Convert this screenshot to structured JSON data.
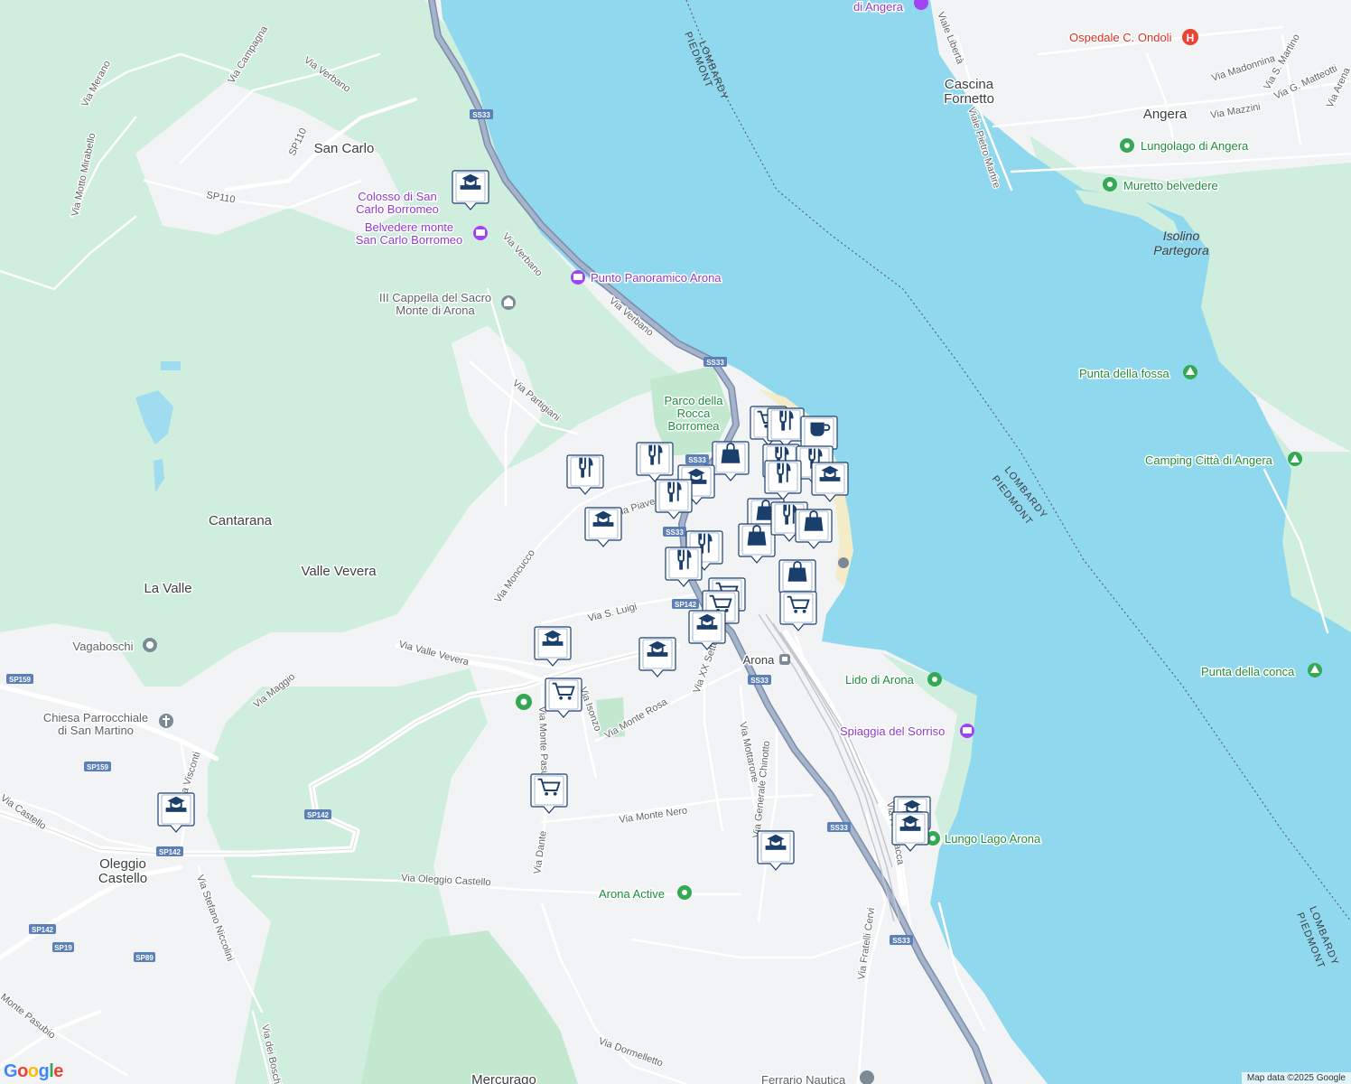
{
  "map": {
    "towns": [
      {
        "name": "San Carlo"
      },
      {
        "name": "Cantarana"
      },
      {
        "name": "Valle Vevera"
      },
      {
        "name": "La Valle"
      },
      {
        "name": "Oleggio"
      },
      {
        "name": "Castello"
      },
      {
        "name": "Angera"
      },
      {
        "name": "Cascina"
      },
      {
        "name": "Fornetto"
      },
      {
        "name": "Arona"
      },
      {
        "name": "Mercurago"
      }
    ],
    "water_labels": [
      {
        "name": "Isolino"
      },
      {
        "name": "Partegora"
      }
    ],
    "borders": [
      {
        "a": "LOMBARDY",
        "b": "PIEDMONT"
      }
    ],
    "roads": [
      "Via Merano",
      "Via Campagna",
      "Via Verbano",
      "Via Motto Mirabello",
      "SP110",
      "SP110",
      "Via Verbano",
      "Via Verbano",
      "Via Partigiani",
      "Via Piave",
      "Via Moncucco",
      "Via S. Luigi",
      "Via Valle Vevera",
      "Via Maggio",
      "Via Isonzo",
      "Via Monte Pasubio",
      "Via Monte Rosa",
      "Via XX Settembre",
      "Via Mottarone",
      "Via Generale Chinotto",
      "Via Monte Nero",
      "Via Dante",
      "Via Oleggio Castello",
      "Via Stefano Niccolini",
      "Via Visconti",
      "Via Castello",
      "Monte Pasubio",
      "Via dei Boschi",
      "Via Dormelletto",
      "Via Fratelli Cervi",
      "Via F. Baracca",
      "Viale Libertà",
      "Viale Pietro Martire",
      "Via Madonnina",
      "Via S. Martino",
      "Via Mazzini",
      "Via G. Matteotti",
      "Via Arena"
    ],
    "shields": [
      "SS33",
      "SS33",
      "SS33",
      "SS33",
      "SS33",
      "SP142",
      "SP142",
      "SP142",
      "SP159",
      "SP159",
      "SP142",
      "SP19",
      "SP89",
      "SP142",
      "SS33",
      "SS33",
      "SP159"
    ],
    "pois": [
      {
        "name": "Colosso di San",
        "name2": "Carlo Borromeo",
        "kind": "purple",
        "icon": "camera-icon"
      },
      {
        "name": "Belvedere monte",
        "name2": "San Carlo Borromeo",
        "kind": "purple",
        "icon": "camera-icon"
      },
      {
        "name": "Punto Panoramico Arona",
        "name2": "",
        "kind": "purple",
        "icon": "camera-icon"
      },
      {
        "name": "III Cappella del Sacro",
        "name2": "Monte di Arona",
        "kind": "gray",
        "icon": "church-icon"
      },
      {
        "name": "Parco della",
        "name2": "Rocca",
        "name3": "Borromea",
        "kind": "green",
        "icon": ""
      },
      {
        "name": "Vagaboschi",
        "name2": "",
        "kind": "gray",
        "icon": "leaf-icon"
      },
      {
        "name": "Chiesa Parrocchiale",
        "name2": "di San Martino",
        "kind": "gray",
        "icon": "cross-icon"
      },
      {
        "name": "Lido di Arona",
        "name2": "",
        "kind": "green",
        "icon": "park-icon"
      },
      {
        "name": "Spiaggia del Sorriso",
        "name2": "",
        "kind": "purple",
        "icon": "camera-icon"
      },
      {
        "name": "Lungo Lago Arona",
        "name2": "",
        "kind": "green",
        "icon": "park-icon"
      },
      {
        "name": "Arona Active",
        "name2": "",
        "kind": "green",
        "icon": "park-icon"
      },
      {
        "name": "Ferrario Nautica",
        "name2": "",
        "kind": "gray",
        "icon": "shop-icon"
      },
      {
        "name": "Ospedale C. Ondoli",
        "name2": "",
        "kind": "red",
        "icon": "hospital-icon"
      },
      {
        "name": "Lungolago di Angera",
        "name2": "",
        "kind": "green",
        "icon": "park-icon"
      },
      {
        "name": "Muretto belvedere",
        "name2": "",
        "kind": "green",
        "icon": "flower-icon"
      },
      {
        "name": "Punta della fossa",
        "name2": "",
        "kind": "green",
        "icon": "tree-icon"
      },
      {
        "name": "Camping Città di Angera",
        "name2": "",
        "kind": "green",
        "icon": "tent-icon"
      },
      {
        "name": "Punta della conca",
        "name2": "",
        "kind": "green",
        "icon": "tree-icon"
      },
      {
        "name": "di Angera",
        "name2": "",
        "kind": "purple",
        "icon": "camera-icon"
      },
      {
        "name": "Arona",
        "name2": "",
        "kind": "gray",
        "icon": "train-icon"
      }
    ],
    "markers": [
      {
        "type": "school"
      },
      {
        "type": "restaurant"
      },
      {
        "type": "restaurant"
      },
      {
        "type": "bag"
      },
      {
        "type": "school"
      },
      {
        "type": "restaurant"
      },
      {
        "type": "school"
      },
      {
        "type": "restaurant"
      },
      {
        "type": "restaurant"
      },
      {
        "type": "cart"
      },
      {
        "type": "restaurant"
      },
      {
        "type": "coffee"
      },
      {
        "type": "restaurant"
      },
      {
        "type": "restaurant"
      },
      {
        "type": "school"
      },
      {
        "type": "restaurant"
      },
      {
        "type": "bag"
      },
      {
        "type": "bag"
      },
      {
        "type": "restaurant"
      },
      {
        "type": "bag"
      },
      {
        "type": "bag"
      },
      {
        "type": "cart"
      },
      {
        "type": "cart"
      },
      {
        "type": "school"
      },
      {
        "type": "school"
      },
      {
        "type": "school"
      },
      {
        "type": "cart"
      },
      {
        "type": "school"
      },
      {
        "type": "school"
      },
      {
        "type": "school"
      },
      {
        "type": "cart"
      },
      {
        "type": "school"
      },
      {
        "type": "cart"
      }
    ]
  },
  "attribution": "Map data ©2025 Google",
  "logo": "Google"
}
